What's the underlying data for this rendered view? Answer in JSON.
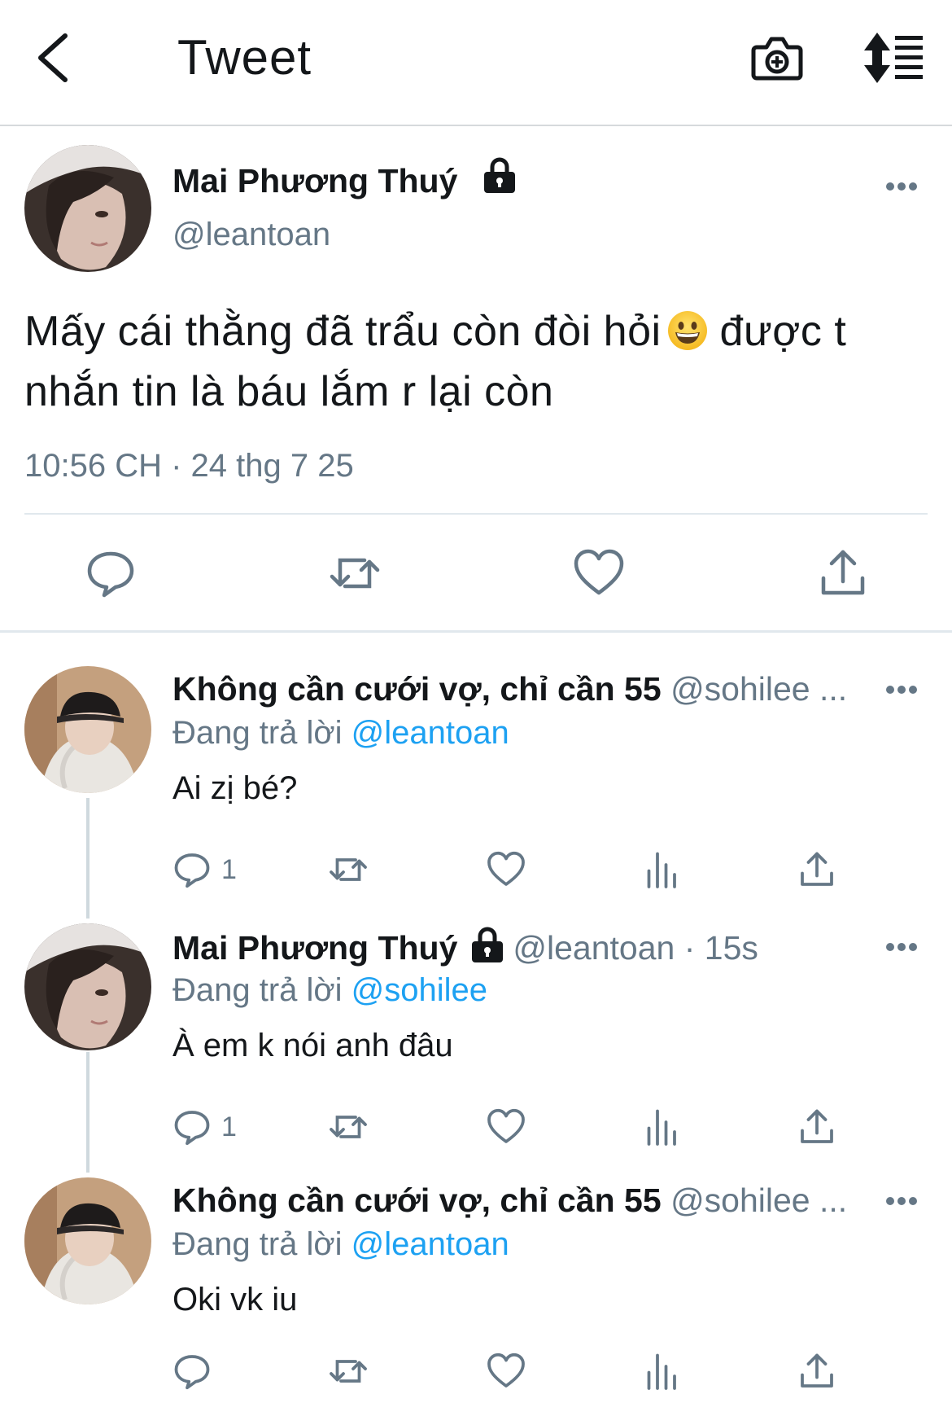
{
  "header": {
    "title": "Tweet"
  },
  "main_tweet": {
    "author_name": "Mai Phương Thuý",
    "handle": "@leantoan",
    "text_part1": "Mấy cái thằng đã trẩu còn đòi hỏi",
    "text_part2": "được t nhắn tin là báu lắm r lại còn",
    "timestamp": "10:56 CH · 24 thg 7 25"
  },
  "replies": [
    {
      "author_name": "Không cần cưới vợ, chỉ cần 55",
      "handle_meta": "@sohilee ...",
      "replying_prefix": "Đang trả lời",
      "replying_to": "@leantoan",
      "text": "Ai zị bé?",
      "reply_count": "1"
    },
    {
      "author_name": "Mai Phương Thuý",
      "handle_meta": "@leantoan · 15s",
      "replying_prefix": "Đang trả lời",
      "replying_to": "@sohilee",
      "text": "À em k nói anh đâu",
      "reply_count": "1"
    },
    {
      "author_name": "Không cần cưới vợ, chỉ cần 55",
      "handle_meta": "@sohilee ...",
      "replying_prefix": "Đang trả lời",
      "replying_to": "@leantoan",
      "text": "Oki vk iu",
      "reply_count": ""
    }
  ],
  "colors": {
    "link": "#1da1f2",
    "secondary_text": "#657786",
    "primary_text": "#14171a",
    "divider": "#e1e8ed"
  },
  "icons": {
    "back": "chevron-left-icon",
    "camera": "camera-plus-icon",
    "sort": "sort-list-icon",
    "lock": "lock-icon",
    "more": "more-dots-icon",
    "reply": "comment-icon",
    "retweet": "retweet-icon",
    "like": "heart-icon",
    "analytics": "analytics-icon",
    "share": "share-icon",
    "emoji": "grinning-face-emoji"
  }
}
